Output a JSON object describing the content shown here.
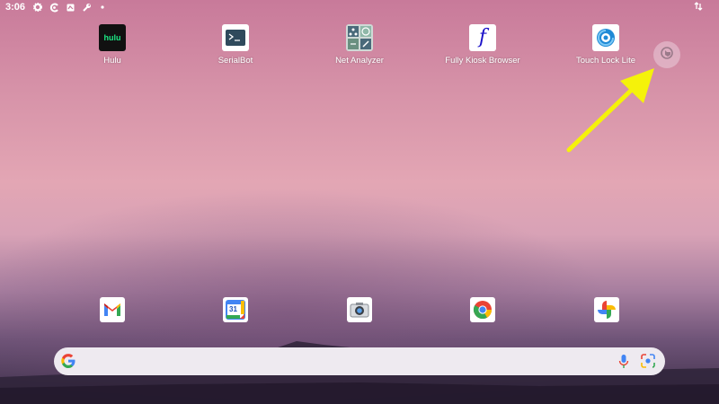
{
  "status_bar": {
    "time": "3:06",
    "left_icons": [
      "gear-icon",
      "fully-kiosk-icon",
      "notification-box-icon",
      "wrench-icon",
      "dot-icon"
    ],
    "right_icons": [
      "data-transfer-icon"
    ]
  },
  "apps": [
    {
      "label": "Hulu",
      "icon": "hulu-icon",
      "icon_text": "hulu"
    },
    {
      "label": "SerialBot",
      "icon": "serialbot-icon"
    },
    {
      "label": "Net Analyzer",
      "icon": "net-analyzer-icon"
    },
    {
      "label": "Fully Kiosk Browser",
      "icon": "fully-kiosk-browser-icon",
      "icon_text": "f"
    },
    {
      "label": "Touch Lock Lite",
      "icon": "touch-lock-lite-icon"
    }
  ],
  "dock": [
    {
      "icon": "gmail-icon"
    },
    {
      "icon": "google-calendar-icon",
      "icon_text": "31"
    },
    {
      "icon": "camera-icon"
    },
    {
      "icon": "chrome-icon"
    },
    {
      "icon": "google-photos-icon"
    }
  ],
  "search": {
    "icons": [
      "google-g-icon",
      "mic-icon",
      "google-lens-icon"
    ]
  },
  "floating_button": {
    "icon": "touch-lock-hand-icon"
  },
  "annotation": {
    "type": "arrow",
    "color": "#f5f20a"
  },
  "colors": {
    "accent_yellow": "#f5f20a",
    "hulu_green": "#1ce783",
    "fully_blue": "#1a10c8"
  }
}
